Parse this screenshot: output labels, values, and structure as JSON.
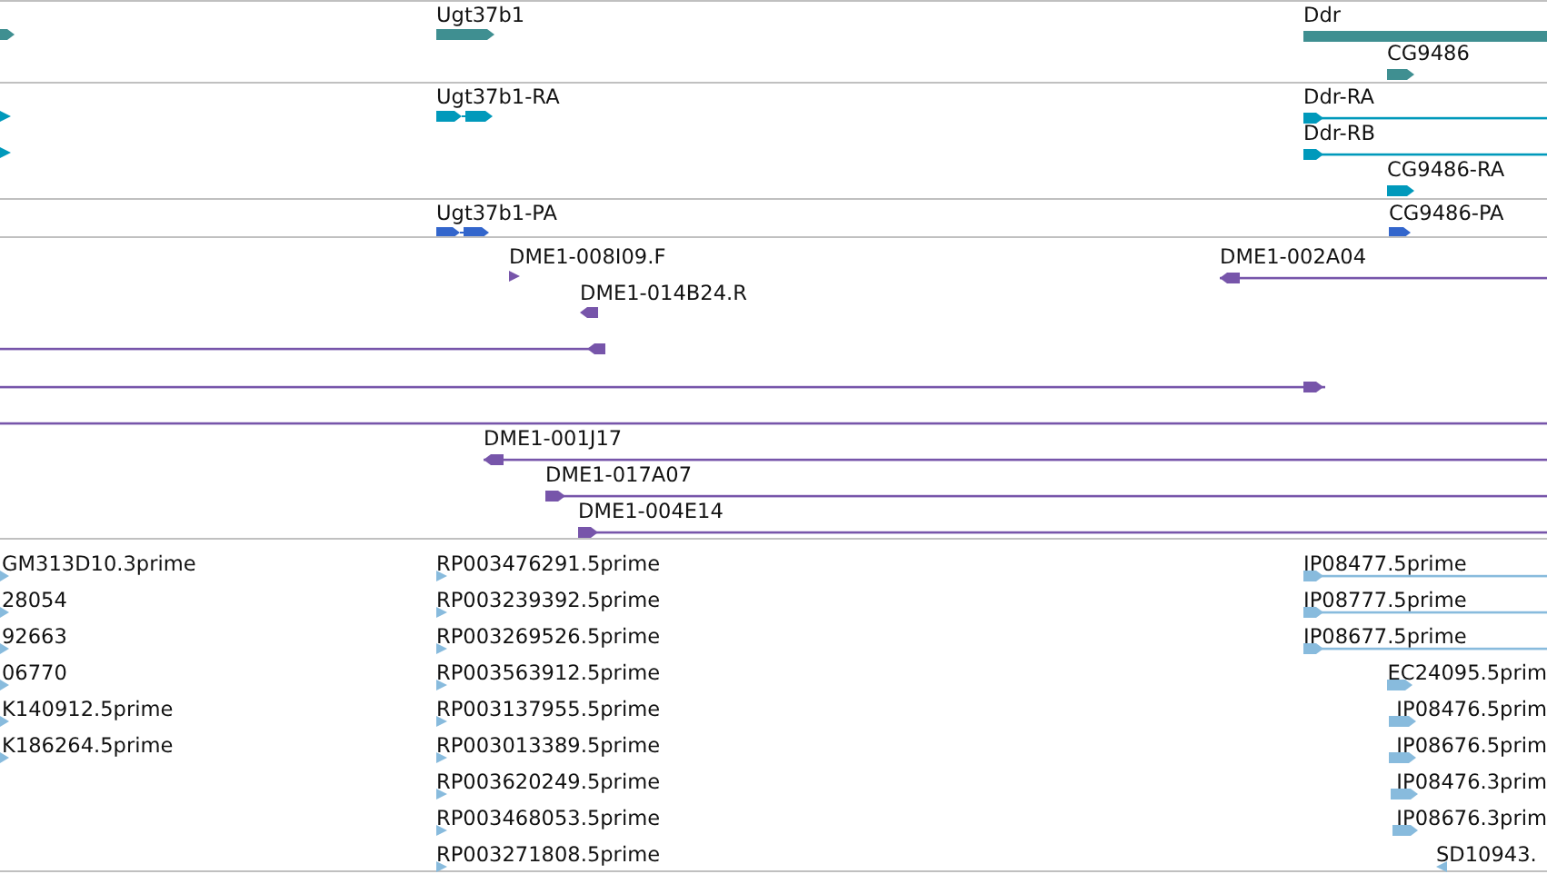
{
  "tracks": [
    {
      "color": "#3f8f91",
      "features": [
        {
          "kind": "block",
          "reverse": false
        },
        {
          "label": "Ugt37b1",
          "kind": "block",
          "reverse": false
        },
        {
          "label": "Ddr",
          "kind": "block"
        },
        {
          "label": "CG9486",
          "kind": "block",
          "reverse": false
        }
      ]
    },
    {
      "color": "#0099bb",
      "features": [
        {
          "kind": "tick",
          "reverse": false
        },
        {
          "kind": "tick",
          "reverse": false
        },
        {
          "label": "Ugt37b1-RA",
          "kind": "exons",
          "reverse": false
        },
        {
          "label": "Ddr-RA",
          "kind": "line",
          "reverse": false
        },
        {
          "label": "Ddr-RB",
          "kind": "line",
          "reverse": false
        },
        {
          "label": "CG9486-RA",
          "kind": "block",
          "reverse": false
        }
      ]
    },
    {
      "color": "#3366cc",
      "features": [
        {
          "label": "Ugt37b1-PA",
          "kind": "exons",
          "reverse": false
        },
        {
          "label": "CG9486-PA",
          "kind": "block",
          "reverse": false
        }
      ]
    },
    {
      "color": "#7755aa",
      "features": [
        {
          "label": "DME1-008I09.F",
          "kind": "tick",
          "reverse": false
        },
        {
          "label": "DME1-014B24.R",
          "kind": "block",
          "reverse": true
        },
        {
          "label": "DME1-002A04",
          "kind": "line",
          "reverse": true
        },
        {
          "kind": "line",
          "reverse": true
        },
        {
          "kind": "line",
          "reverse": false
        },
        {
          "kind": "line"
        },
        {
          "label": "DME1-001J17",
          "kind": "line",
          "reverse": true
        },
        {
          "label": "DME1-017A07",
          "kind": "line",
          "reverse": false
        },
        {
          "label": "DME1-004E14",
          "kind": "line",
          "reverse": false
        }
      ]
    },
    {
      "color": "#88bbdd",
      "features": [
        {
          "label": "GM313D10.3prime",
          "kind": "tick",
          "reverse": false
        },
        {
          "label": "28054",
          "kind": "tick",
          "reverse": false
        },
        {
          "label": "92663",
          "kind": "tick",
          "reverse": false
        },
        {
          "label": "06770",
          "kind": "tick",
          "reverse": false
        },
        {
          "label": "K140912.5prime",
          "kind": "tick",
          "reverse": false
        },
        {
          "label": "K186264.5prime",
          "kind": "tick",
          "reverse": false
        },
        {
          "label": "RP003476291.5prime",
          "kind": "tick",
          "reverse": false
        },
        {
          "label": "RP003239392.5prime",
          "kind": "tick",
          "reverse": false
        },
        {
          "label": "RP003269526.5prime",
          "kind": "tick",
          "reverse": false
        },
        {
          "label": "RP003563912.5prime",
          "kind": "tick",
          "reverse": false
        },
        {
          "label": "RP003137955.5prime",
          "kind": "tick",
          "reverse": false
        },
        {
          "label": "RP003013389.5prime",
          "kind": "tick",
          "reverse": false
        },
        {
          "label": "RP003620249.5prime",
          "kind": "tick",
          "reverse": false
        },
        {
          "label": "RP003468053.5prime",
          "kind": "tick",
          "reverse": false
        },
        {
          "label": "RP003271808.5prime",
          "kind": "tick",
          "reverse": false
        },
        {
          "label": "IP08477.5prime",
          "kind": "line",
          "reverse": false
        },
        {
          "label": "IP08777.5prime",
          "kind": "line",
          "reverse": false
        },
        {
          "label": "IP08677.5prime",
          "kind": "line",
          "reverse": false
        },
        {
          "label": "EC24095.5prim",
          "kind": "block",
          "reverse": false
        },
        {
          "label": "IP08476.5prim",
          "kind": "block",
          "reverse": false
        },
        {
          "label": "IP08676.5prim",
          "kind": "block",
          "reverse": false
        },
        {
          "label": "IP08476.3prim",
          "kind": "block",
          "reverse": false
        },
        {
          "label": "IP08676.3prim",
          "kind": "block",
          "reverse": false
        },
        {
          "label": "SD10943.",
          "kind": "tick",
          "reverse": true
        }
      ]
    }
  ]
}
